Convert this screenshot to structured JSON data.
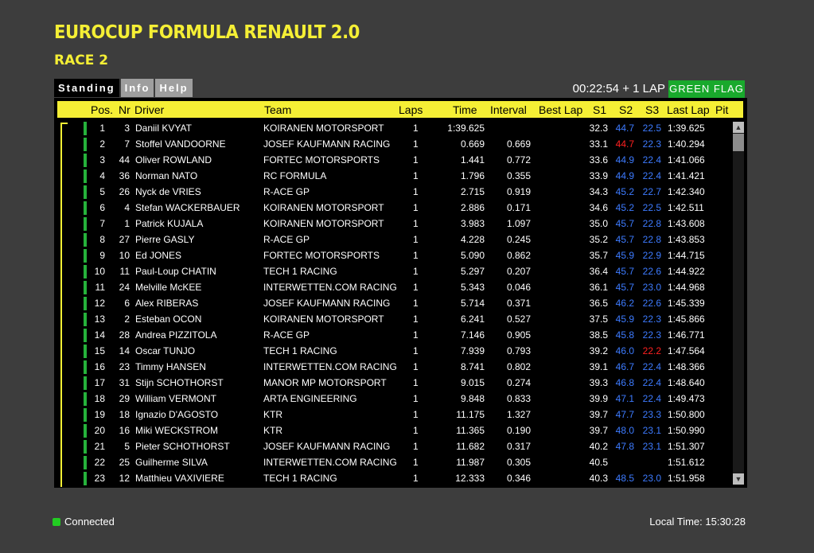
{
  "title": "EUROCUP FORMULA RENAULT 2.0",
  "subtitle": "RACE 2",
  "tabs": [
    "Standing",
    "Info",
    "Help"
  ],
  "session": {
    "clock": "00:22:54 + 1 LAP",
    "flag": "GREEN FLAG"
  },
  "colors": {
    "accent": "#f5ef35",
    "flag": "#19a92c",
    "best_sector": "#3d7bff",
    "slow_sector": "#ff2020",
    "background": "#3d3d3d"
  },
  "columns": {
    "pos": "Pos.",
    "nr": "Nr",
    "driver": "Driver",
    "team": "Team",
    "laps": "Laps",
    "time": "Time",
    "interval": "Interval",
    "best_lap": "Best Lap",
    "s1": "S1",
    "s2": "S2",
    "s3": "S3",
    "last_lap": "Last Lap",
    "pit": "Pit"
  },
  "rows": [
    {
      "pos": "1",
      "nr": "3",
      "driver": "Daniil KVYAT",
      "team": "KOIRANEN MOTORSPORT",
      "laps": "1",
      "time": "1:39.625",
      "interval": "",
      "best": "",
      "s1": "32.3",
      "s2": "44.7",
      "s2c": "blue",
      "s3": "22.5",
      "s3c": "blue",
      "last": "1:39.625",
      "pit": ""
    },
    {
      "pos": "2",
      "nr": "7",
      "driver": "Stoffel VANDOORNE",
      "team": "JOSEF KAUFMANN RACING",
      "laps": "1",
      "time": "0.669",
      "interval": "0.669",
      "best": "",
      "s1": "33.1",
      "s2": "44.7",
      "s2c": "red",
      "s3": "22.3",
      "s3c": "blue",
      "last": "1:40.294",
      "pit": ""
    },
    {
      "pos": "3",
      "nr": "44",
      "driver": "Oliver ROWLAND",
      "team": "FORTEC MOTORSPORTS",
      "laps": "1",
      "time": "1.441",
      "interval": "0.772",
      "best": "",
      "s1": "33.6",
      "s2": "44.9",
      "s2c": "blue",
      "s3": "22.4",
      "s3c": "blue",
      "last": "1:41.066",
      "pit": ""
    },
    {
      "pos": "4",
      "nr": "36",
      "driver": "Norman NATO",
      "team": "RC FORMULA",
      "laps": "1",
      "time": "1.796",
      "interval": "0.355",
      "best": "",
      "s1": "33.9",
      "s2": "44.9",
      "s2c": "blue",
      "s3": "22.4",
      "s3c": "blue",
      "last": "1:41.421",
      "pit": ""
    },
    {
      "pos": "5",
      "nr": "26",
      "driver": "Nyck de VRIES",
      "team": "R-ACE GP",
      "laps": "1",
      "time": "2.715",
      "interval": "0.919",
      "best": "",
      "s1": "34.3",
      "s2": "45.2",
      "s2c": "blue",
      "s3": "22.7",
      "s3c": "blue",
      "last": "1:42.340",
      "pit": ""
    },
    {
      "pos": "6",
      "nr": "4",
      "driver": "Stefan WACKERBAUER",
      "team": "KOIRANEN MOTORSPORT",
      "laps": "1",
      "time": "2.886",
      "interval": "0.171",
      "best": "",
      "s1": "34.6",
      "s2": "45.2",
      "s2c": "blue",
      "s3": "22.5",
      "s3c": "blue",
      "last": "1:42.511",
      "pit": ""
    },
    {
      "pos": "7",
      "nr": "1",
      "driver": "Patrick KUJALA",
      "team": "KOIRANEN MOTORSPORT",
      "laps": "1",
      "time": "3.983",
      "interval": "1.097",
      "best": "",
      "s1": "35.0",
      "s2": "45.7",
      "s2c": "blue",
      "s3": "22.8",
      "s3c": "blue",
      "last": "1:43.608",
      "pit": ""
    },
    {
      "pos": "8",
      "nr": "27",
      "driver": "Pierre GASLY",
      "team": "R-ACE GP",
      "laps": "1",
      "time": "4.228",
      "interval": "0.245",
      "best": "",
      "s1": "35.2",
      "s2": "45.7",
      "s2c": "blue",
      "s3": "22.8",
      "s3c": "blue",
      "last": "1:43.853",
      "pit": ""
    },
    {
      "pos": "9",
      "nr": "10",
      "driver": "Ed JONES",
      "team": "FORTEC MOTORSPORTS",
      "laps": "1",
      "time": "5.090",
      "interval": "0.862",
      "best": "",
      "s1": "35.7",
      "s2": "45.9",
      "s2c": "blue",
      "s3": "22.9",
      "s3c": "blue",
      "last": "1:44.715",
      "pit": ""
    },
    {
      "pos": "10",
      "nr": "11",
      "driver": "Paul-Loup CHATIN",
      "team": "TECH 1 RACING",
      "laps": "1",
      "time": "5.297",
      "interval": "0.207",
      "best": "",
      "s1": "36.4",
      "s2": "45.7",
      "s2c": "blue",
      "s3": "22.6",
      "s3c": "blue",
      "last": "1:44.922",
      "pit": ""
    },
    {
      "pos": "11",
      "nr": "24",
      "driver": "Melville McKEE",
      "team": "INTERWETTEN.COM RACING",
      "laps": "1",
      "time": "5.343",
      "interval": "0.046",
      "best": "",
      "s1": "36.1",
      "s2": "45.7",
      "s2c": "blue",
      "s3": "23.0",
      "s3c": "blue",
      "last": "1:44.968",
      "pit": ""
    },
    {
      "pos": "12",
      "nr": "6",
      "driver": "Alex RIBERAS",
      "team": "JOSEF KAUFMANN RACING",
      "laps": "1",
      "time": "5.714",
      "interval": "0.371",
      "best": "",
      "s1": "36.5",
      "s2": "46.2",
      "s2c": "blue",
      "s3": "22.6",
      "s3c": "blue",
      "last": "1:45.339",
      "pit": ""
    },
    {
      "pos": "13",
      "nr": "2",
      "driver": "Esteban OCON",
      "team": "KOIRANEN MOTORSPORT",
      "laps": "1",
      "time": "6.241",
      "interval": "0.527",
      "best": "",
      "s1": "37.5",
      "s2": "45.9",
      "s2c": "blue",
      "s3": "22.3",
      "s3c": "blue",
      "last": "1:45.866",
      "pit": ""
    },
    {
      "pos": "14",
      "nr": "28",
      "driver": "Andrea PIZZITOLA",
      "team": "R-ACE GP",
      "laps": "1",
      "time": "7.146",
      "interval": "0.905",
      "best": "",
      "s1": "38.5",
      "s2": "45.8",
      "s2c": "blue",
      "s3": "22.3",
      "s3c": "blue",
      "last": "1:46.771",
      "pit": ""
    },
    {
      "pos": "15",
      "nr": "14",
      "driver": "Oscar TUNJO",
      "team": "TECH 1 RACING",
      "laps": "1",
      "time": "7.939",
      "interval": "0.793",
      "best": "",
      "s1": "39.2",
      "s2": "46.0",
      "s2c": "blue",
      "s3": "22.2",
      "s3c": "red",
      "last": "1:47.564",
      "pit": ""
    },
    {
      "pos": "16",
      "nr": "23",
      "driver": "Timmy HANSEN",
      "team": "INTERWETTEN.COM RACING",
      "laps": "1",
      "time": "8.741",
      "interval": "0.802",
      "best": "",
      "s1": "39.1",
      "s2": "46.7",
      "s2c": "blue",
      "s3": "22.4",
      "s3c": "blue",
      "last": "1:48.366",
      "pit": ""
    },
    {
      "pos": "17",
      "nr": "31",
      "driver": "Stijn SCHOTHORST",
      "team": "MANOR MP MOTORSPORT",
      "laps": "1",
      "time": "9.015",
      "interval": "0.274",
      "best": "",
      "s1": "39.3",
      "s2": "46.8",
      "s2c": "blue",
      "s3": "22.4",
      "s3c": "blue",
      "last": "1:48.640",
      "pit": ""
    },
    {
      "pos": "18",
      "nr": "29",
      "driver": "William VERMONT",
      "team": "ARTA ENGINEERING",
      "laps": "1",
      "time": "9.848",
      "interval": "0.833",
      "best": "",
      "s1": "39.9",
      "s2": "47.1",
      "s2c": "blue",
      "s3": "22.4",
      "s3c": "blue",
      "last": "1:49.473",
      "pit": ""
    },
    {
      "pos": "19",
      "nr": "18",
      "driver": "Ignazio D'AGOSTO",
      "team": "KTR",
      "laps": "1",
      "time": "11.175",
      "interval": "1.327",
      "best": "",
      "s1": "39.7",
      "s2": "47.7",
      "s2c": "blue",
      "s3": "23.3",
      "s3c": "blue",
      "last": "1:50.800",
      "pit": ""
    },
    {
      "pos": "20",
      "nr": "16",
      "driver": "Miki WECKSTROM",
      "team": "KTR",
      "laps": "1",
      "time": "11.365",
      "interval": "0.190",
      "best": "",
      "s1": "39.7",
      "s2": "48.0",
      "s2c": "blue",
      "s3": "23.1",
      "s3c": "blue",
      "last": "1:50.990",
      "pit": ""
    },
    {
      "pos": "21",
      "nr": "5",
      "driver": "Pieter SCHOTHORST",
      "team": "JOSEF KAUFMANN RACING",
      "laps": "1",
      "time": "11.682",
      "interval": "0.317",
      "best": "",
      "s1": "40.2",
      "s2": "47.8",
      "s2c": "blue",
      "s3": "23.1",
      "s3c": "blue",
      "last": "1:51.307",
      "pit": ""
    },
    {
      "pos": "22",
      "nr": "25",
      "driver": "Guilherme SILVA",
      "team": "INTERWETTEN.COM RACING",
      "laps": "1",
      "time": "11.987",
      "interval": "0.305",
      "best": "",
      "s1": "40.5",
      "s2": "",
      "s2c": "blue",
      "s3": "",
      "s3c": "blue",
      "last": "1:51.612",
      "pit": ""
    },
    {
      "pos": "23",
      "nr": "12",
      "driver": "Matthieu VAXIVIERE",
      "team": "TECH 1 RACING",
      "laps": "1",
      "time": "12.333",
      "interval": "0.346",
      "best": "",
      "s1": "40.3",
      "s2": "48.5",
      "s2c": "blue",
      "s3": "23.0",
      "s3c": "blue",
      "last": "1:51.958",
      "pit": ""
    }
  ],
  "footer": {
    "status": "Connected",
    "local_time": "Local Time: 15:30:28"
  }
}
